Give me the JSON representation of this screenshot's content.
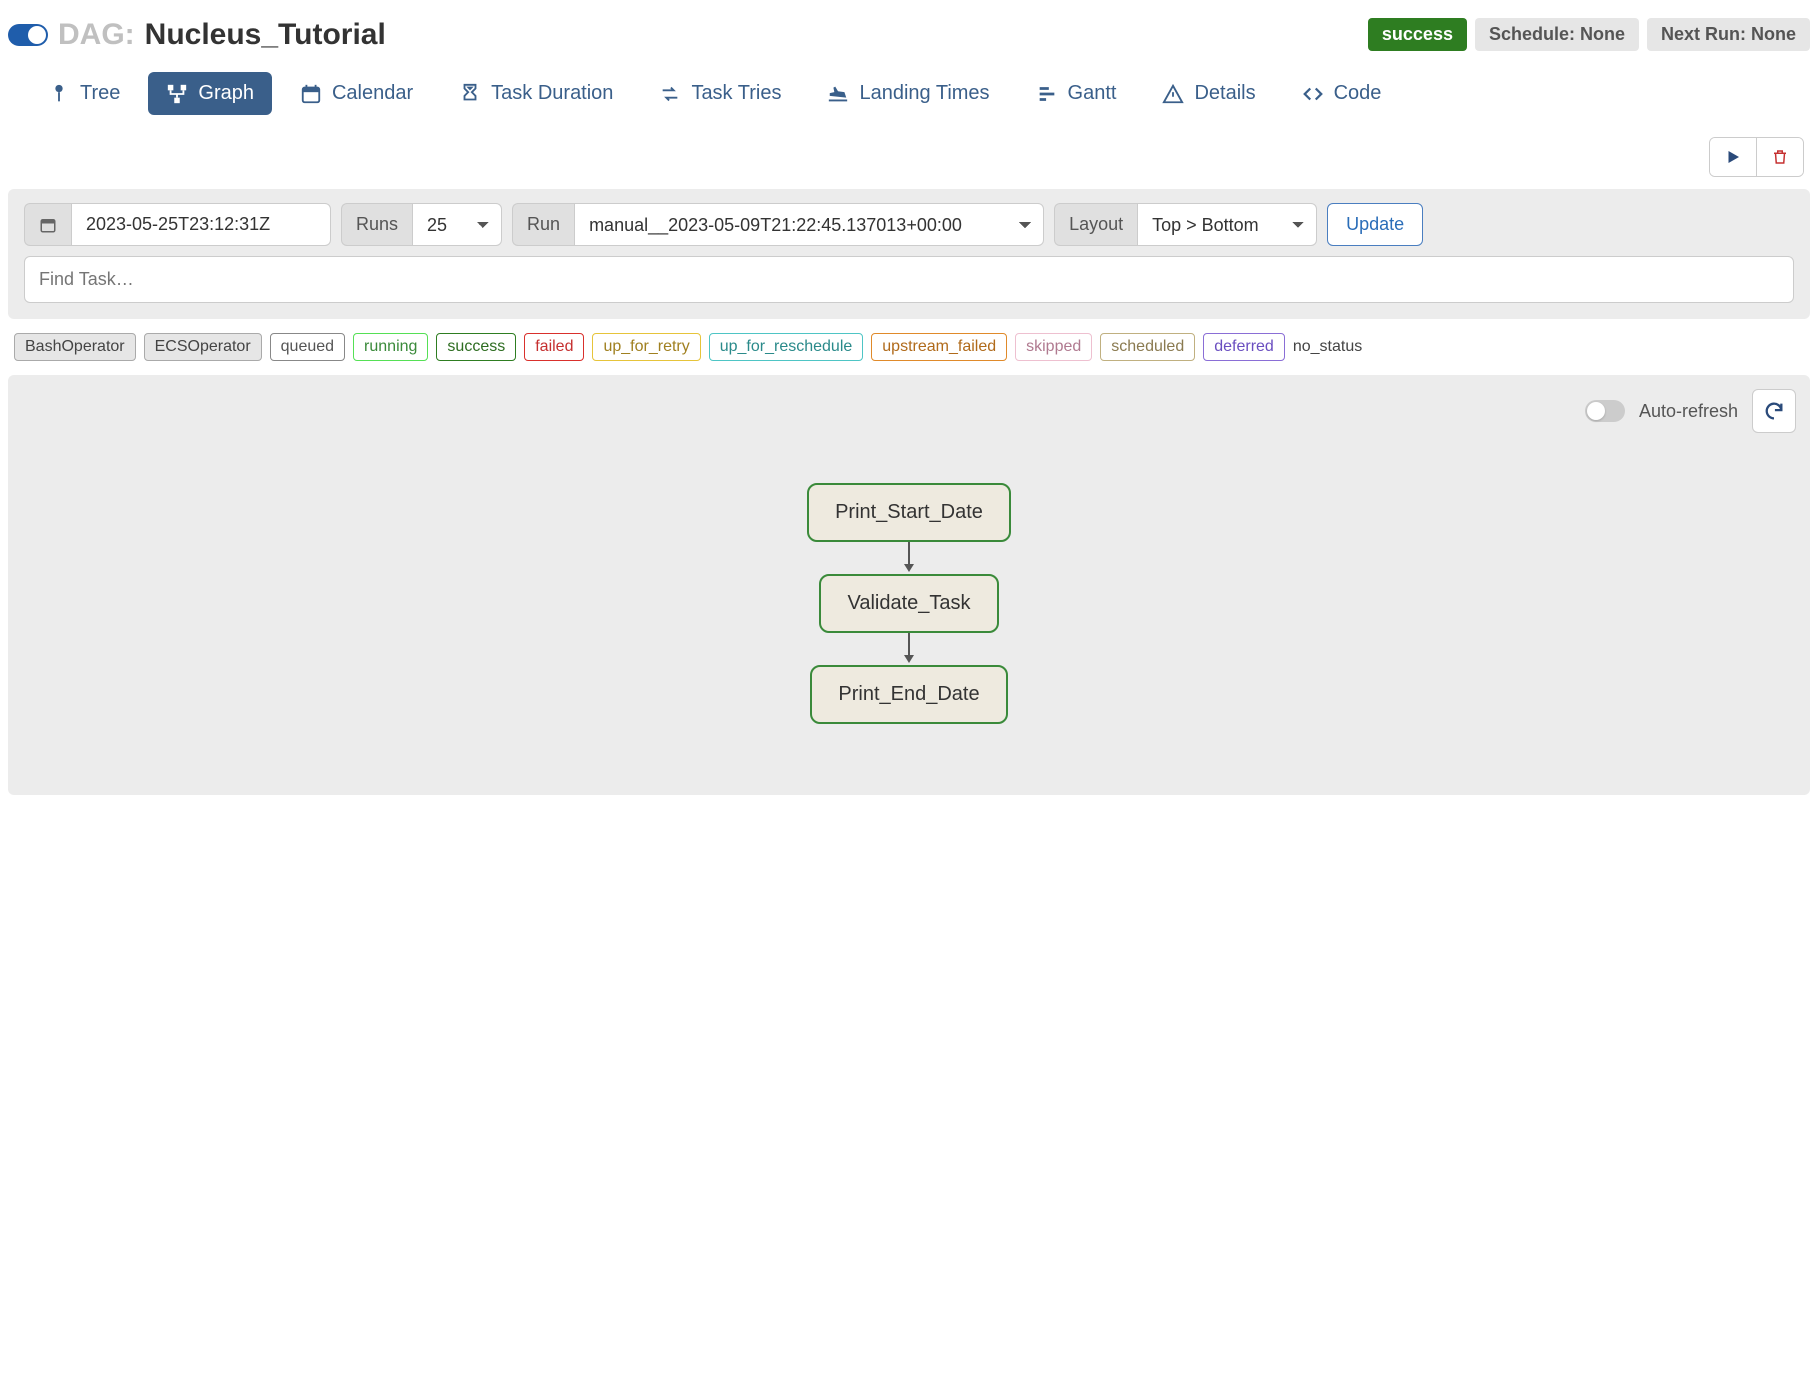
{
  "header": {
    "dag_prefix": "DAG:",
    "dag_name": "Nucleus_Tutorial",
    "status_badge": "success",
    "schedule_badge": "Schedule: None",
    "next_run_badge": "Next Run: None"
  },
  "tabs": [
    {
      "label": "Tree"
    },
    {
      "label": "Graph"
    },
    {
      "label": "Calendar"
    },
    {
      "label": "Task Duration"
    },
    {
      "label": "Task Tries"
    },
    {
      "label": "Landing Times"
    },
    {
      "label": "Gantt"
    },
    {
      "label": "Details"
    },
    {
      "label": "Code"
    }
  ],
  "controls": {
    "date_value": "2023-05-25T23:12:31Z",
    "runs_label": "Runs",
    "runs_value": "25",
    "run_label": "Run",
    "run_value": "manual__2023-05-09T21:22:45.137013+00:00",
    "layout_label": "Layout",
    "layout_value": "Top > Bottom",
    "update_label": "Update",
    "find_placeholder": "Find Task…"
  },
  "legend": {
    "operators": [
      "BashOperator",
      "ECSOperator"
    ],
    "statuses": [
      {
        "label": "queued",
        "color": "#888"
      },
      {
        "label": "running",
        "color": "#55e055"
      },
      {
        "label": "success",
        "color": "#2e7d21"
      },
      {
        "label": "failed",
        "color": "#d9302c"
      },
      {
        "label": "up_for_retry",
        "color": "#e6c43a"
      },
      {
        "label": "up_for_reschedule",
        "color": "#4ec5c5"
      },
      {
        "label": "upstream_failed",
        "color": "#e08a2a"
      },
      {
        "label": "skipped",
        "color": "#eec0d0"
      },
      {
        "label": "scheduled",
        "color": "#c0b080"
      },
      {
        "label": "deferred",
        "color": "#8a6ed6"
      }
    ],
    "no_status": "no_status"
  },
  "graph": {
    "auto_refresh_label": "Auto-refresh",
    "nodes": [
      "Print_Start_Date",
      "Validate_Task",
      "Print_End_Date"
    ]
  }
}
